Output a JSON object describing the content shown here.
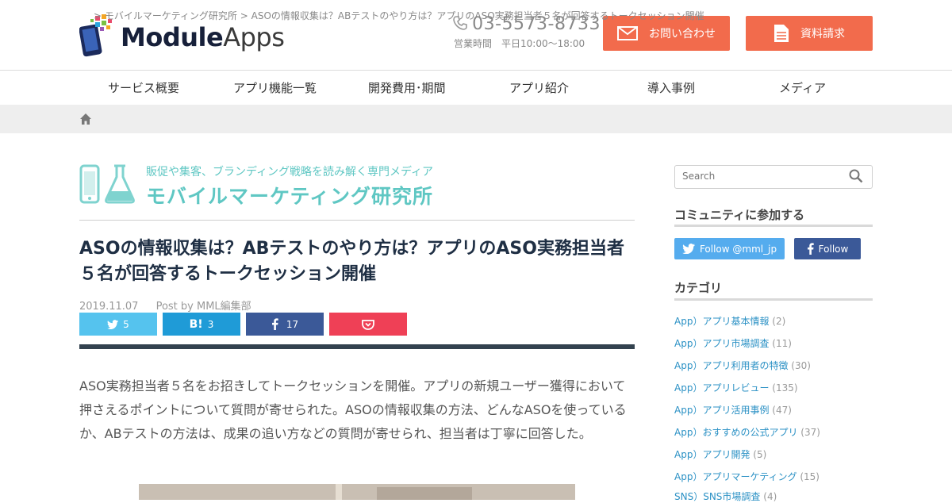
{
  "header": {
    "logo": {
      "part1": "Module",
      "part2": "Apps"
    },
    "phone": "03-5573-8733",
    "hours": "営業時間　平日10:00〜18:00",
    "contact_label": "お問い合わせ",
    "document_label": "資料請求",
    "accent_color": "#f26b4c"
  },
  "nav": [
    "サービス概要",
    "アプリ機能一覧",
    "開発費用･期間",
    "アプリ紹介",
    "導入事例",
    "メディア"
  ],
  "breadcrumb": {
    "sep1": ">",
    "item1": "モバイルマーケティング研究所",
    "sep2": ">",
    "item2": "ASOの情報収集は？ABテストのやり方は？アプリのASO実務担当者５名が回答するトークセッション開催"
  },
  "media": {
    "tagline": "販促や集客、ブランディング戦略を読み解く専門メディア",
    "name": "モバイルマーケティング研究所",
    "color": "#5fc7c3"
  },
  "article": {
    "title": "ASOの情報収集は？ABテストのやり方は？アプリのASO実務担当者５名が回答するトークセッション開催",
    "date": "2019.11.07",
    "author": "Post by MML編集部",
    "share": {
      "twitter": "5",
      "hatena": "3",
      "facebook": "17",
      "pocket": ""
    },
    "body": "ASO実務担当者５名をお招きしてトークセッションを開催。アプリの新規ユーザー獲得において押さえるポイントについて質問が寄せられた。ASOの情報収集の方法、どんなASOを使っているか、ABテストの方法は、成果の追い方などの質問が寄せられ、担当者は丁寧に回答した。"
  },
  "sidebar": {
    "search_placeholder": "Search",
    "community_heading": "コミュニティに参加する",
    "twitter_label": "Follow @mml_jp",
    "facebook_label": "Follow",
    "category_heading": "カテゴリ",
    "categories": [
      {
        "label": "App）アプリ基本情報",
        "count": "(2)"
      },
      {
        "label": "App）アプリ市場調査",
        "count": "(11)"
      },
      {
        "label": "App）アプリ利用者の特徴",
        "count": "(30)"
      },
      {
        "label": "App）アプリレビュー",
        "count": "(135)"
      },
      {
        "label": "App）アプリ活用事例",
        "count": "(47)"
      },
      {
        "label": "App）おすすめの公式アプリ",
        "count": "(37)"
      },
      {
        "label": "App）アプリ開発",
        "count": "(5)"
      },
      {
        "label": "App）アプリマーケティング",
        "count": "(15)"
      },
      {
        "label": "SNS）SNS市場調査",
        "count": "(4)"
      }
    ]
  }
}
